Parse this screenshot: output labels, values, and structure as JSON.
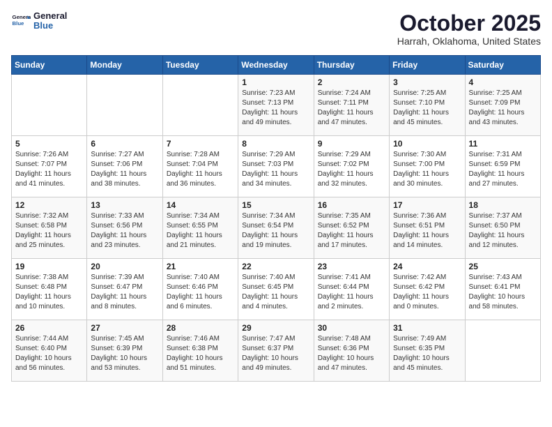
{
  "logo": {
    "general": "General",
    "blue": "Blue"
  },
  "title": "October 2025",
  "subtitle": "Harrah, Oklahoma, United States",
  "weekdays": [
    "Sunday",
    "Monday",
    "Tuesday",
    "Wednesday",
    "Thursday",
    "Friday",
    "Saturday"
  ],
  "weeks": [
    [
      {
        "day": "",
        "info": ""
      },
      {
        "day": "",
        "info": ""
      },
      {
        "day": "",
        "info": ""
      },
      {
        "day": "1",
        "info": "Sunrise: 7:23 AM\nSunset: 7:13 PM\nDaylight: 11 hours and 49 minutes."
      },
      {
        "day": "2",
        "info": "Sunrise: 7:24 AM\nSunset: 7:11 PM\nDaylight: 11 hours and 47 minutes."
      },
      {
        "day": "3",
        "info": "Sunrise: 7:25 AM\nSunset: 7:10 PM\nDaylight: 11 hours and 45 minutes."
      },
      {
        "day": "4",
        "info": "Sunrise: 7:25 AM\nSunset: 7:09 PM\nDaylight: 11 hours and 43 minutes."
      }
    ],
    [
      {
        "day": "5",
        "info": "Sunrise: 7:26 AM\nSunset: 7:07 PM\nDaylight: 11 hours and 41 minutes."
      },
      {
        "day": "6",
        "info": "Sunrise: 7:27 AM\nSunset: 7:06 PM\nDaylight: 11 hours and 38 minutes."
      },
      {
        "day": "7",
        "info": "Sunrise: 7:28 AM\nSunset: 7:04 PM\nDaylight: 11 hours and 36 minutes."
      },
      {
        "day": "8",
        "info": "Sunrise: 7:29 AM\nSunset: 7:03 PM\nDaylight: 11 hours and 34 minutes."
      },
      {
        "day": "9",
        "info": "Sunrise: 7:29 AM\nSunset: 7:02 PM\nDaylight: 11 hours and 32 minutes."
      },
      {
        "day": "10",
        "info": "Sunrise: 7:30 AM\nSunset: 7:00 PM\nDaylight: 11 hours and 30 minutes."
      },
      {
        "day": "11",
        "info": "Sunrise: 7:31 AM\nSunset: 6:59 PM\nDaylight: 11 hours and 27 minutes."
      }
    ],
    [
      {
        "day": "12",
        "info": "Sunrise: 7:32 AM\nSunset: 6:58 PM\nDaylight: 11 hours and 25 minutes."
      },
      {
        "day": "13",
        "info": "Sunrise: 7:33 AM\nSunset: 6:56 PM\nDaylight: 11 hours and 23 minutes."
      },
      {
        "day": "14",
        "info": "Sunrise: 7:34 AM\nSunset: 6:55 PM\nDaylight: 11 hours and 21 minutes."
      },
      {
        "day": "15",
        "info": "Sunrise: 7:34 AM\nSunset: 6:54 PM\nDaylight: 11 hours and 19 minutes."
      },
      {
        "day": "16",
        "info": "Sunrise: 7:35 AM\nSunset: 6:52 PM\nDaylight: 11 hours and 17 minutes."
      },
      {
        "day": "17",
        "info": "Sunrise: 7:36 AM\nSunset: 6:51 PM\nDaylight: 11 hours and 14 minutes."
      },
      {
        "day": "18",
        "info": "Sunrise: 7:37 AM\nSunset: 6:50 PM\nDaylight: 11 hours and 12 minutes."
      }
    ],
    [
      {
        "day": "19",
        "info": "Sunrise: 7:38 AM\nSunset: 6:48 PM\nDaylight: 11 hours and 10 minutes."
      },
      {
        "day": "20",
        "info": "Sunrise: 7:39 AM\nSunset: 6:47 PM\nDaylight: 11 hours and 8 minutes."
      },
      {
        "day": "21",
        "info": "Sunrise: 7:40 AM\nSunset: 6:46 PM\nDaylight: 11 hours and 6 minutes."
      },
      {
        "day": "22",
        "info": "Sunrise: 7:40 AM\nSunset: 6:45 PM\nDaylight: 11 hours and 4 minutes."
      },
      {
        "day": "23",
        "info": "Sunrise: 7:41 AM\nSunset: 6:44 PM\nDaylight: 11 hours and 2 minutes."
      },
      {
        "day": "24",
        "info": "Sunrise: 7:42 AM\nSunset: 6:42 PM\nDaylight: 11 hours and 0 minutes."
      },
      {
        "day": "25",
        "info": "Sunrise: 7:43 AM\nSunset: 6:41 PM\nDaylight: 10 hours and 58 minutes."
      }
    ],
    [
      {
        "day": "26",
        "info": "Sunrise: 7:44 AM\nSunset: 6:40 PM\nDaylight: 10 hours and 56 minutes."
      },
      {
        "day": "27",
        "info": "Sunrise: 7:45 AM\nSunset: 6:39 PM\nDaylight: 10 hours and 53 minutes."
      },
      {
        "day": "28",
        "info": "Sunrise: 7:46 AM\nSunset: 6:38 PM\nDaylight: 10 hours and 51 minutes."
      },
      {
        "day": "29",
        "info": "Sunrise: 7:47 AM\nSunset: 6:37 PM\nDaylight: 10 hours and 49 minutes."
      },
      {
        "day": "30",
        "info": "Sunrise: 7:48 AM\nSunset: 6:36 PM\nDaylight: 10 hours and 47 minutes."
      },
      {
        "day": "31",
        "info": "Sunrise: 7:49 AM\nSunset: 6:35 PM\nDaylight: 10 hours and 45 minutes."
      },
      {
        "day": "",
        "info": ""
      }
    ]
  ]
}
